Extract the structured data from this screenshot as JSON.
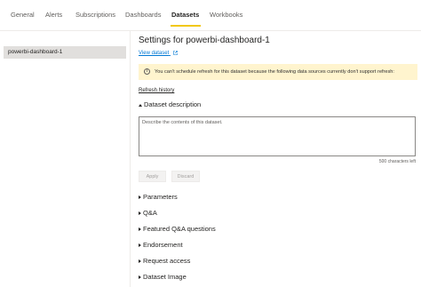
{
  "tabs": [
    {
      "label": "General"
    },
    {
      "label": "Alerts"
    },
    {
      "label": "Subscriptions"
    },
    {
      "label": "Dashboards"
    },
    {
      "label": "Datasets",
      "active": true
    },
    {
      "label": "Workbooks"
    }
  ],
  "sidebar": {
    "items": [
      {
        "label": "powerbi-dashboard-1",
        "selected": true
      }
    ]
  },
  "main": {
    "title": "Settings for powerbi-dashboard-1",
    "view_link": "View dataset",
    "banner": "You can't schedule refresh for this dataset because the following data sources currently don't support refresh:",
    "refresh_history": "Refresh history",
    "description": {
      "heading": "Dataset description",
      "placeholder": "Describe the contents of this dataset.",
      "char_count": "500 characters left"
    },
    "buttons": {
      "apply": "Apply",
      "discard": "Discard"
    },
    "sections": [
      {
        "label": "Parameters"
      },
      {
        "label": "Q&A"
      },
      {
        "label": "Featured Q&A questions"
      },
      {
        "label": "Endorsement"
      },
      {
        "label": "Request access"
      },
      {
        "label": "Dataset Image"
      }
    ]
  },
  "colors": {
    "accent": "#f2c811",
    "link": "#0078d4",
    "banner": "#fff4ce",
    "selected": "#e1dfdd"
  },
  "icons": [
    "info-icon",
    "external-link-icon",
    "caret-right-icon",
    "caret-up-icon"
  ]
}
